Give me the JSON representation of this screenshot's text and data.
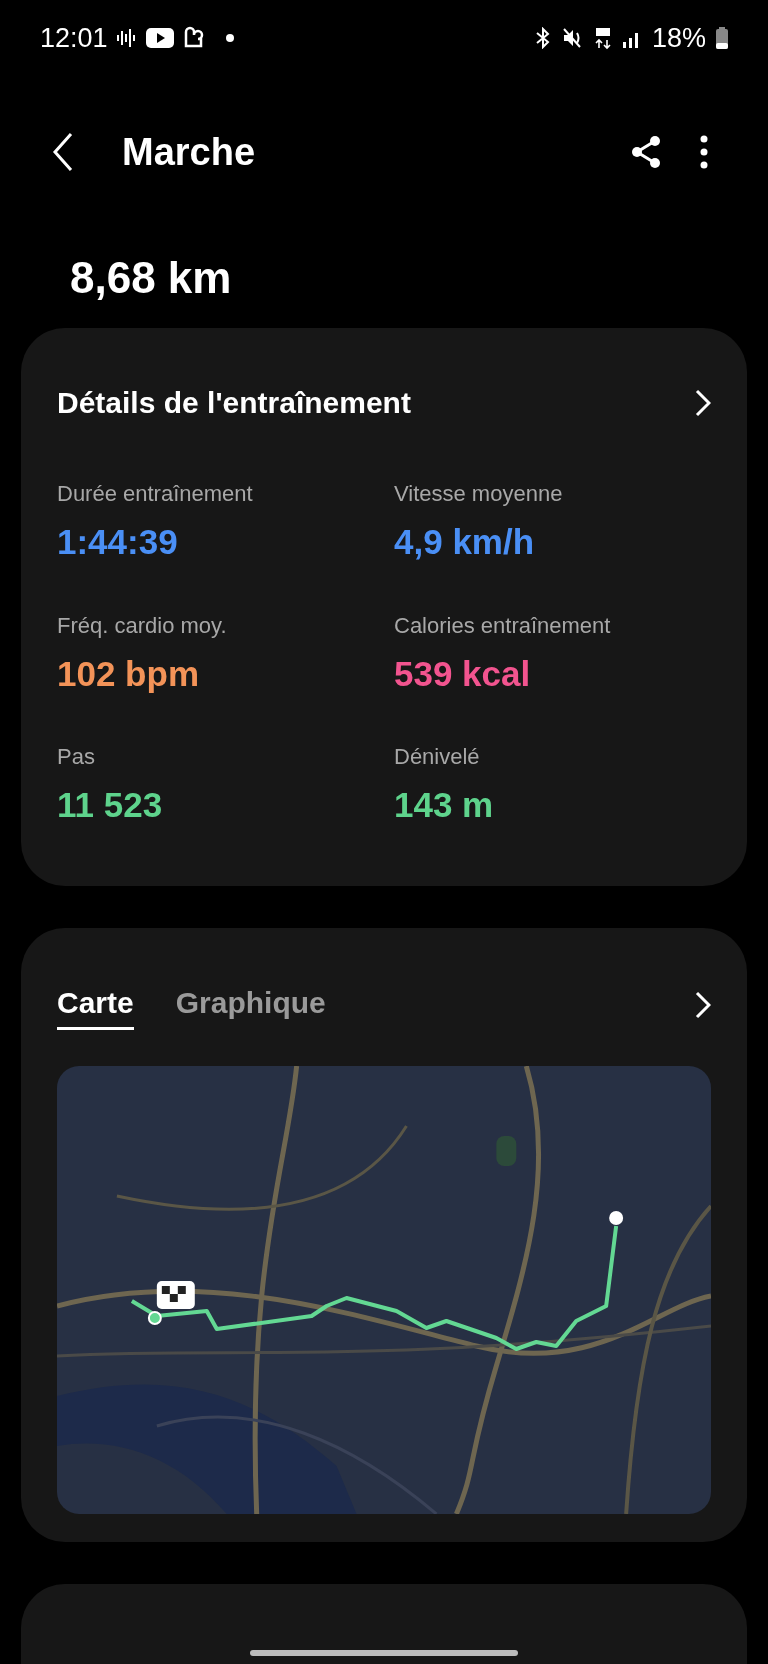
{
  "status_bar": {
    "time": "12:01",
    "battery": "18%"
  },
  "header": {
    "title": "Marche"
  },
  "distance": "8,68 km",
  "details": {
    "title": "Détails de l'entraînement",
    "stats": [
      {
        "label": "Durée entraînement",
        "value": "1:44:39",
        "color": "#4a8ff5"
      },
      {
        "label": "Vitesse moyenne",
        "value": "4,9 km/h",
        "color": "#4a8ff5"
      },
      {
        "label": "Fréq. cardio moy.",
        "value": "102 bpm",
        "color": "#f39358"
      },
      {
        "label": "Calories entraînement",
        "value": "539 kcal",
        "color": "#f2548f"
      },
      {
        "label": "Pas",
        "value": "11 523",
        "color": "#5ed38c"
      },
      {
        "label": "Dénivelé",
        "value": "143 m",
        "color": "#5ed38c"
      }
    ]
  },
  "tabs": [
    {
      "label": "Carte",
      "selected": true
    },
    {
      "label": "Graphique",
      "selected": false
    }
  ]
}
